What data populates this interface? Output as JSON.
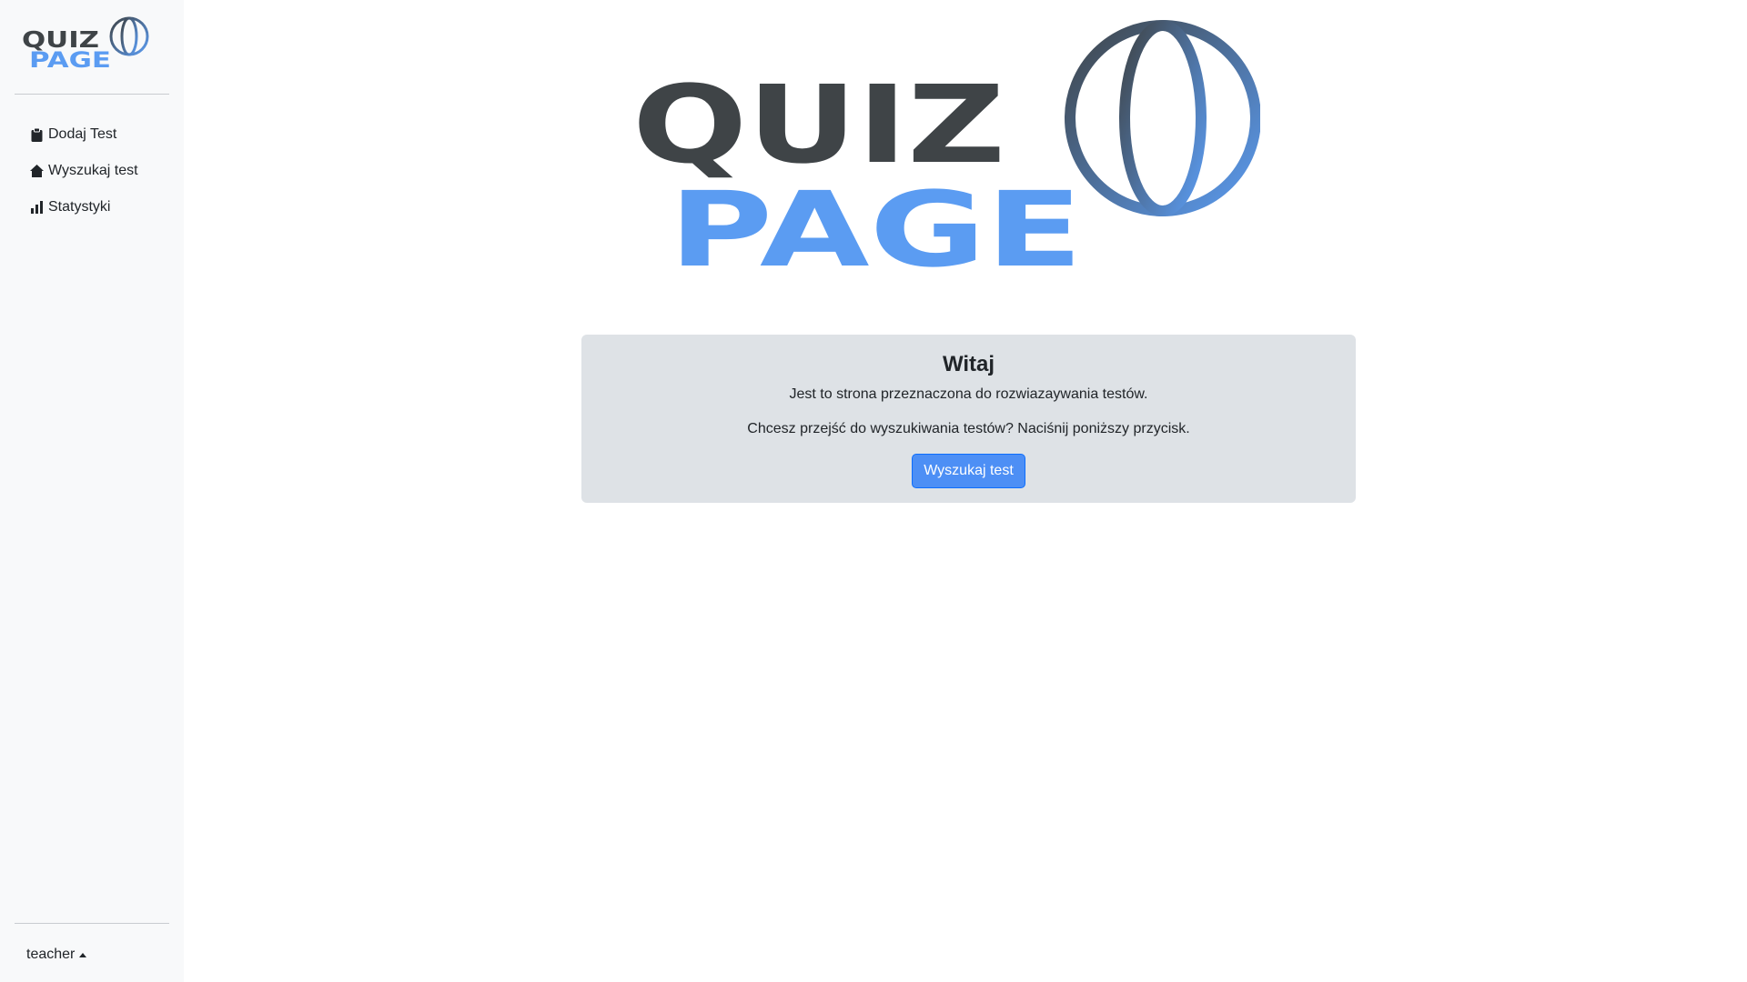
{
  "brand": {
    "word1": "QUIZ",
    "word2": "PAGE",
    "dark_color": "#3f4447",
    "blue_color": "#5b9cf2"
  },
  "sidebar": {
    "items": [
      {
        "label": "Dodaj Test",
        "icon": "clipboard-icon"
      },
      {
        "label": "Wyszukaj test",
        "icon": "home-icon"
      },
      {
        "label": "Statystyki",
        "icon": "bar-chart-icon"
      }
    ],
    "user": {
      "name": "teacher",
      "icon": "caret-up-icon"
    }
  },
  "welcome": {
    "title": "Witaj",
    "line1": "Jest to strona przeznaczona do rozwiazaywania testów.",
    "line2": "Chcesz przejść do wyszukiwania testów? Naciśnij poniższy przycisk.",
    "button_label": "Wyszukaj test"
  },
  "colors": {
    "sidebar_bg": "#f8f9fa",
    "card_bg": "#dee2e6",
    "button_bg": "#4d8ff5"
  }
}
